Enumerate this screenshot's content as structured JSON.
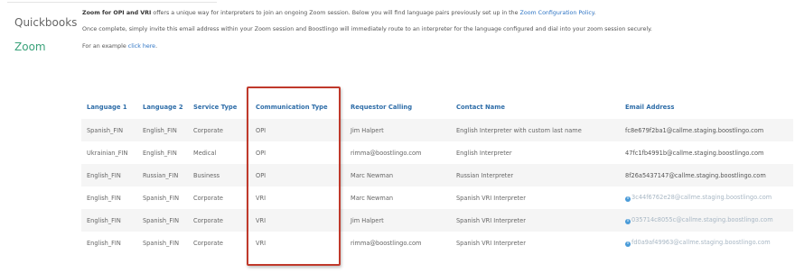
{
  "sidebar": {
    "items": [
      {
        "label": "Quickbooks"
      },
      {
        "label": "Zoom"
      }
    ]
  },
  "intro": {
    "line1_bold": "Zoom for OPI and VRI",
    "line1_text": " offers a unique way for interpreters to join an ongoing Zoom session. Below you will find language pairs previously set up in the ",
    "line1_link": "Zoom Configuration Policy",
    "line1_end": ".",
    "line2_text": "Once complete, simply invite this email address within your Zoom session and Boostlingo will immediately route to an interpreter for the language configured and dial into your zoom session securely.",
    "line3_text": "For an example ",
    "line3_link": "click here",
    "line3_end": "."
  },
  "table": {
    "headers": [
      "Language 1",
      "Language 2",
      "Service Type",
      "Communication Type",
      "Requestor Calling",
      "Contact Name",
      "Email Address"
    ],
    "rows": [
      {
        "lang1": "Spanish_FIN",
        "lang2": "English_FIN",
        "service": "Corporate",
        "comm": "OPI",
        "requestor": "Jim Halpert",
        "contact": "English Interpreter with custom last name",
        "email": "fc8e679f2ba1@callme.staging.boostlingo.com",
        "info": false
      },
      {
        "lang1": "Ukrainian_FIN",
        "lang2": "English_FIN",
        "service": "Medical",
        "comm": "OPI",
        "requestor": "rimma@boostlingo.com",
        "contact": "English Interpreter",
        "email": "47fc1fb4991b@callme.staging.boostlingo.com",
        "info": false
      },
      {
        "lang1": "English_FIN",
        "lang2": "Russian_FIN",
        "service": "Business",
        "comm": "OPI",
        "requestor": "Marc Newman",
        "contact": "Russian Interpreter",
        "email": "8f26a5437147@callme.staging.boostlingo.com",
        "info": false
      },
      {
        "lang1": "English_FIN",
        "lang2": "Spanish_FIN",
        "service": "Corporate",
        "comm": "VRI",
        "requestor": "Marc Newman",
        "contact": "Spanish VRI Interpreter",
        "email": "3c44f6762e28@callme.staging.boostlingo.com",
        "info": true
      },
      {
        "lang1": "English_FIN",
        "lang2": "Spanish_FIN",
        "service": "Corporate",
        "comm": "VRI",
        "requestor": "Jim Halpert",
        "contact": "Spanish VRI Interpreter",
        "email": "035714c8055c@callme.staging.boostlingo.com",
        "info": true
      },
      {
        "lang1": "English_FIN",
        "lang2": "Spanish_FIN",
        "service": "Corporate",
        "comm": "VRI",
        "requestor": "rimma@boostlingo.com",
        "contact": "Spanish VRI Interpreter",
        "email": "fd0a9af49963@callme.staging.boostlingo.com",
        "info": true
      }
    ]
  },
  "colors": {
    "accent_green": "#3aa27a",
    "link_blue": "#2e74c4",
    "header_blue": "#2e6da8",
    "highlight_red": "#c0392b"
  }
}
